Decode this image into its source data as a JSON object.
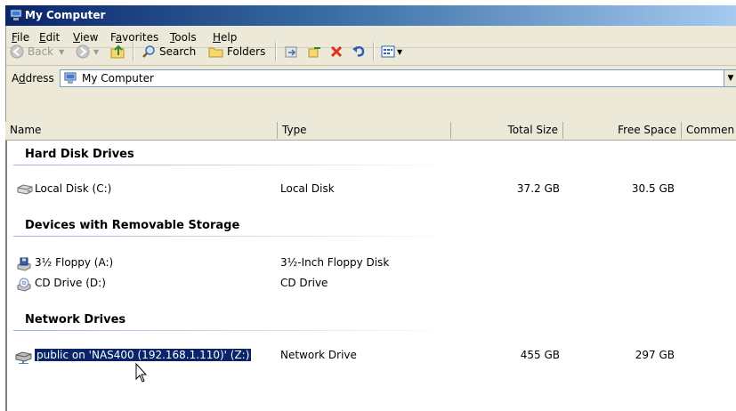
{
  "window": {
    "title": "My Computer"
  },
  "menu": [
    {
      "label": "File",
      "accel": "F",
      "rest": "ile"
    },
    {
      "label": "Edit",
      "accel": "E",
      "rest": "dit"
    },
    {
      "label": "View",
      "accel": "V",
      "rest": "iew"
    },
    {
      "label": "Favorites",
      "accel": "a",
      "pre": "F",
      "rest": "vorites"
    },
    {
      "label": "Tools",
      "accel": "T",
      "rest": "ools"
    },
    {
      "label": "Help",
      "accel": "H",
      "rest": "elp"
    }
  ],
  "toolbar": {
    "back_label": "Back",
    "search_label": "Search",
    "folders_label": "Folders"
  },
  "address": {
    "label": "Address",
    "accel": "d",
    "value": "My Computer"
  },
  "columns": {
    "name": "Name",
    "type": "Type",
    "total": "Total Size",
    "free": "Free Space",
    "comments": "Commen"
  },
  "groups": {
    "hard": {
      "title": "Hard Disk Drives",
      "items": [
        {
          "name": "Local Disk (C:)",
          "type": "Local Disk",
          "total": "37.2 GB",
          "free": "30.5 GB",
          "icon": "hard-disk-icon"
        }
      ]
    },
    "removable": {
      "title": "Devices with Removable Storage",
      "items": [
        {
          "name": "3½ Floppy (A:)",
          "type": "3½-Inch Floppy Disk",
          "total": "",
          "free": "",
          "icon": "floppy-drive-icon"
        },
        {
          "name": "CD Drive (D:)",
          "type": "CD Drive",
          "total": "",
          "free": "",
          "icon": "cd-drive-icon"
        }
      ]
    },
    "network": {
      "title": "Network Drives",
      "items": [
        {
          "name": "public on 'NAS400 (192.168.1.110)' (Z:)",
          "type": "Network Drive",
          "total": "455 GB",
          "free": "297 GB",
          "icon": "network-drive-icon",
          "selected": true
        }
      ]
    }
  },
  "colors": {
    "title_start": "#0a246a",
    "title_end": "#a6caf0",
    "selection": "#0a246a",
    "chrome": "#ece9d8"
  }
}
